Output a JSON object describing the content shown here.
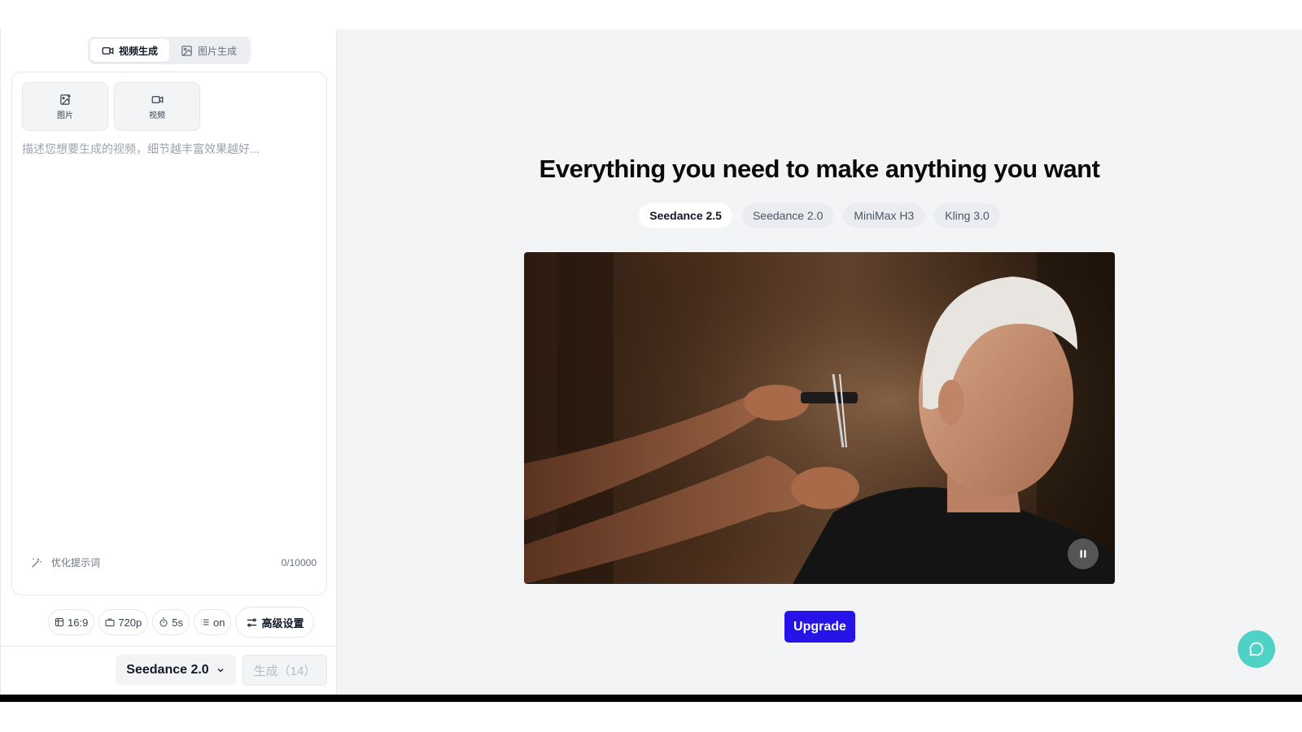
{
  "sidebar": {
    "mode_tabs": [
      {
        "label": "视频生成",
        "icon": "video-icon",
        "active": true
      },
      {
        "label": "图片生成",
        "icon": "image-icon",
        "active": false
      }
    ],
    "upload_buttons": [
      {
        "label": "图片",
        "icon": "image-plus-icon"
      },
      {
        "label": "视频",
        "icon": "video-icon"
      }
    ],
    "prompt": {
      "value": "",
      "placeholder": "描述您想要生成的视频，细节越丰富效果越好..."
    },
    "optimize_label": "优化提示词",
    "char_count": "0/10000",
    "settings": {
      "aspect_ratio": "16:9",
      "resolution": "720p",
      "duration": "5s",
      "audio": "on",
      "advanced_label": "高级设置"
    },
    "model_selected": "Seedance 2.0",
    "generate_label": "生成（14）"
  },
  "main": {
    "headline": "Everything you need to make anything you want",
    "model_tabs": [
      {
        "label": "Seedance 2.5",
        "active": true
      },
      {
        "label": "Seedance 2.0",
        "active": false
      },
      {
        "label": "MiniMax H3",
        "active": false
      },
      {
        "label": "Kling 3.0",
        "active": false
      }
    ],
    "upgrade_label": "Upgrade"
  },
  "colors": {
    "accent": "#2513e8",
    "chat_fab": "#4fd1c5",
    "background": "#f3f4f6"
  }
}
